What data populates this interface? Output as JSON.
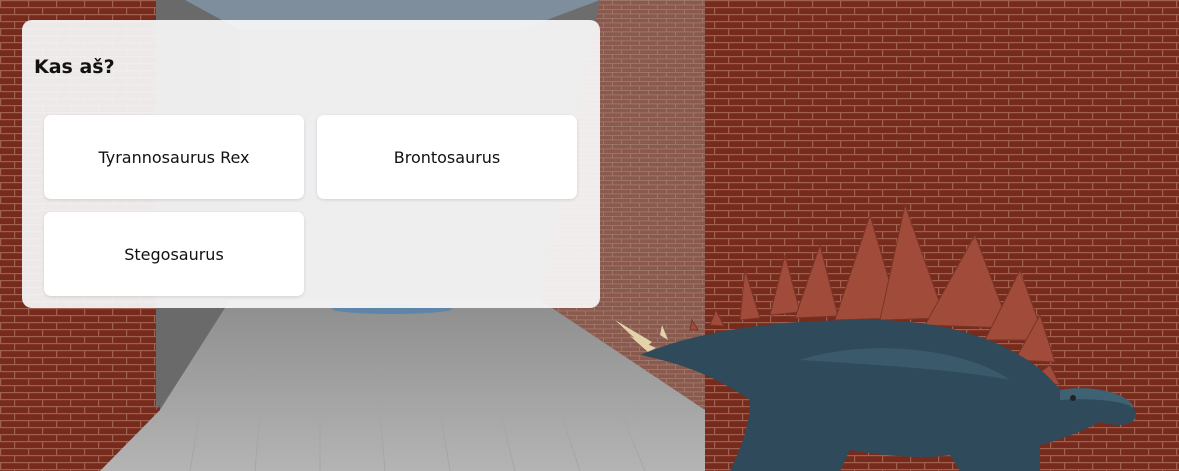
{
  "quiz": {
    "question": "Kas aš?",
    "answers": [
      {
        "label": "Tyrannosaurus Rex"
      },
      {
        "label": "Brontosaurus"
      },
      {
        "label": "Stegosaurus"
      }
    ]
  },
  "scene": {
    "wall_color": "#7a2e1f",
    "mortar_color": "#9a5a48",
    "floor_color": "#b9b9b9",
    "ceiling_light_color": "#8aa0b3",
    "dinosaur_body_color": "#2f4b5c",
    "dinosaur_plate_color": "#9a4a38"
  }
}
